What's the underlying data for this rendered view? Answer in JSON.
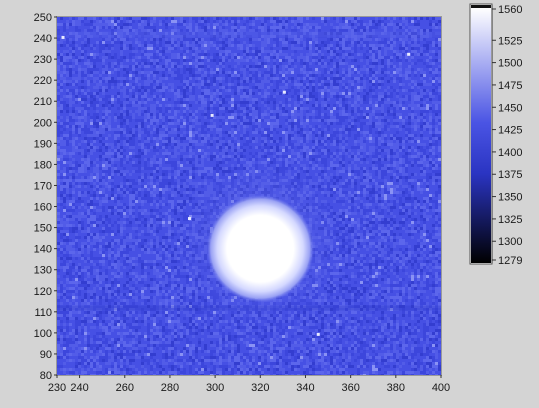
{
  "chart_data": {
    "type": "heatmap",
    "title": "",
    "xlabel": "",
    "ylabel": "",
    "xlim": [
      230,
      400
    ],
    "ylim": [
      80,
      250
    ],
    "x_ticks": [
      230,
      240,
      260,
      280,
      300,
      320,
      340,
      360,
      380,
      400
    ],
    "y_ticks": [
      80,
      90,
      100,
      110,
      120,
      130,
      140,
      150,
      160,
      170,
      180,
      190,
      200,
      210,
      220,
      230,
      240,
      250
    ],
    "colorbar": {
      "min": 1279,
      "max": 1560,
      "ticks": [
        1279,
        1300,
        1325,
        1350,
        1375,
        1400,
        1425,
        1450,
        1475,
        1500,
        1525,
        1560
      ],
      "colors": [
        "#000000",
        "#3a44d6",
        "#ffffff"
      ]
    },
    "background_level": 1370,
    "bright_spot": {
      "center_x": 320,
      "center_y": 140,
      "radius": 14,
      "peak_value": 1560
    },
    "grid": false
  }
}
